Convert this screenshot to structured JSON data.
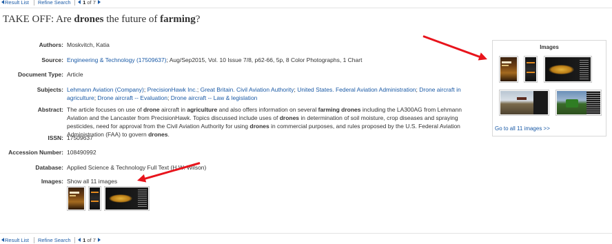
{
  "nav": {
    "result_list": "Result List",
    "refine_search": "Refine Search",
    "pager_current": "1",
    "pager_of": "of 7"
  },
  "record": {
    "title_parts": [
      "TAKE OFF: Are ",
      "drones",
      " the future of ",
      "farming",
      "?"
    ],
    "fields": {
      "authors": {
        "label": "Authors:",
        "value": "Moskvitch, Katia"
      },
      "source": {
        "label": "Source:",
        "link": "Engineering & Technology (17509637)",
        "rest": "; Aug/Sep2015, Vol. 10 Issue 7/8, p62-66, 5p, 8 Color Photographs, 1 Chart"
      },
      "doc_type": {
        "label": "Document Type:",
        "value": "Article"
      },
      "subjects": {
        "label": "Subjects:",
        "items": [
          "Lehmann Aviation (Company)",
          "PrecisionHawk Inc.",
          "Great Britain. Civil Aviation Authority",
          "United States. Federal Aviation Administration",
          "Drone aircraft in agriculture",
          "Drone aircraft -- Evaluation",
          "Drone aircraft -- Law & legislation"
        ]
      },
      "abstract": {
        "label": "Abstract:",
        "parts": [
          [
            "The article focuses on use of ",
            false
          ],
          [
            "drone",
            true
          ],
          [
            " aircraft in ",
            false
          ],
          [
            "agriculture",
            true
          ],
          [
            " and also offers information on several ",
            false
          ],
          [
            "farming drones",
            true
          ],
          [
            " including the LA300AG from Lehmann Aviation and the Lancaster from PrecisionHawk. Topics discussed include uses of ",
            false
          ],
          [
            "drones",
            true
          ],
          [
            " in determination of soil moisture, crop diseases and spraying pesticides, need for approval from the Civil Aviation Authority for using ",
            false
          ],
          [
            "drones",
            true
          ],
          [
            " in commercial purposes, and rules proposed by the U.S. Federal Aviation Administration (FAA) to govern ",
            false
          ],
          [
            "drones",
            true
          ],
          [
            ".",
            false
          ]
        ]
      },
      "issn": {
        "label": "ISSN:",
        "value": "17509637"
      },
      "accession": {
        "label": "Accession Number:",
        "value": "108490992"
      },
      "database": {
        "label": "Database:",
        "value": "Applied Science & Technology Full Text (H.W. Wilson)"
      },
      "images": {
        "label": "Images:",
        "show_all": "Show all 11 images"
      }
    }
  },
  "images_panel": {
    "title": "Images",
    "go_to_all": "Go to all 11 images >>"
  },
  "colors": {
    "link": "#1a5aa6",
    "annotation_arrow": "#e8141c"
  }
}
